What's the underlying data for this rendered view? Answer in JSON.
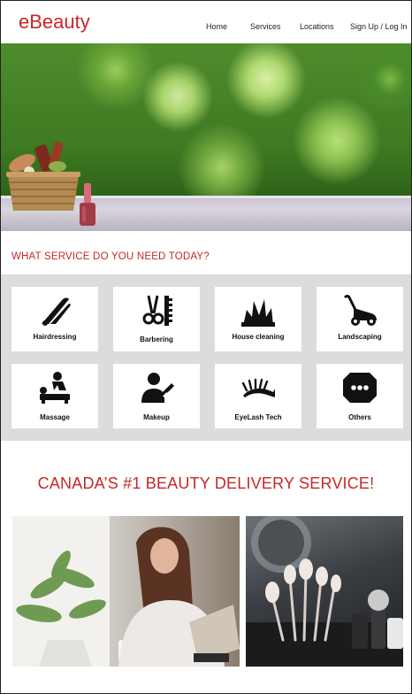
{
  "header": {
    "logo": "eBeauty",
    "nav": {
      "home": "Home",
      "services": "Services",
      "locations": "Locations",
      "signup": "Sign Up / Log In"
    }
  },
  "services": {
    "title": "WHAT SERVICE DO YOU NEED TODAY?",
    "items": [
      {
        "label": "Hairdressing",
        "icon": "hair-iron-icon"
      },
      {
        "label": "Barbering",
        "icon": "scissors-comb-icon"
      },
      {
        "label": "House cleaning",
        "icon": "cleaning-icon"
      },
      {
        "label": "Landscaping",
        "icon": "lawn-mower-icon"
      },
      {
        "label": "Massage",
        "icon": "massage-icon"
      },
      {
        "label": "Makeup",
        "icon": "makeup-icon"
      },
      {
        "label": "EyeLash Tech",
        "icon": "eyelash-icon"
      },
      {
        "label": "Others",
        "icon": "speech-bubble-icon"
      }
    ]
  },
  "tagline": "CANADA’S #1 BEAUTY DELIVERY SERVICE!",
  "colors": {
    "brand": "#c62828",
    "grid_bg": "#dcdcdc"
  }
}
